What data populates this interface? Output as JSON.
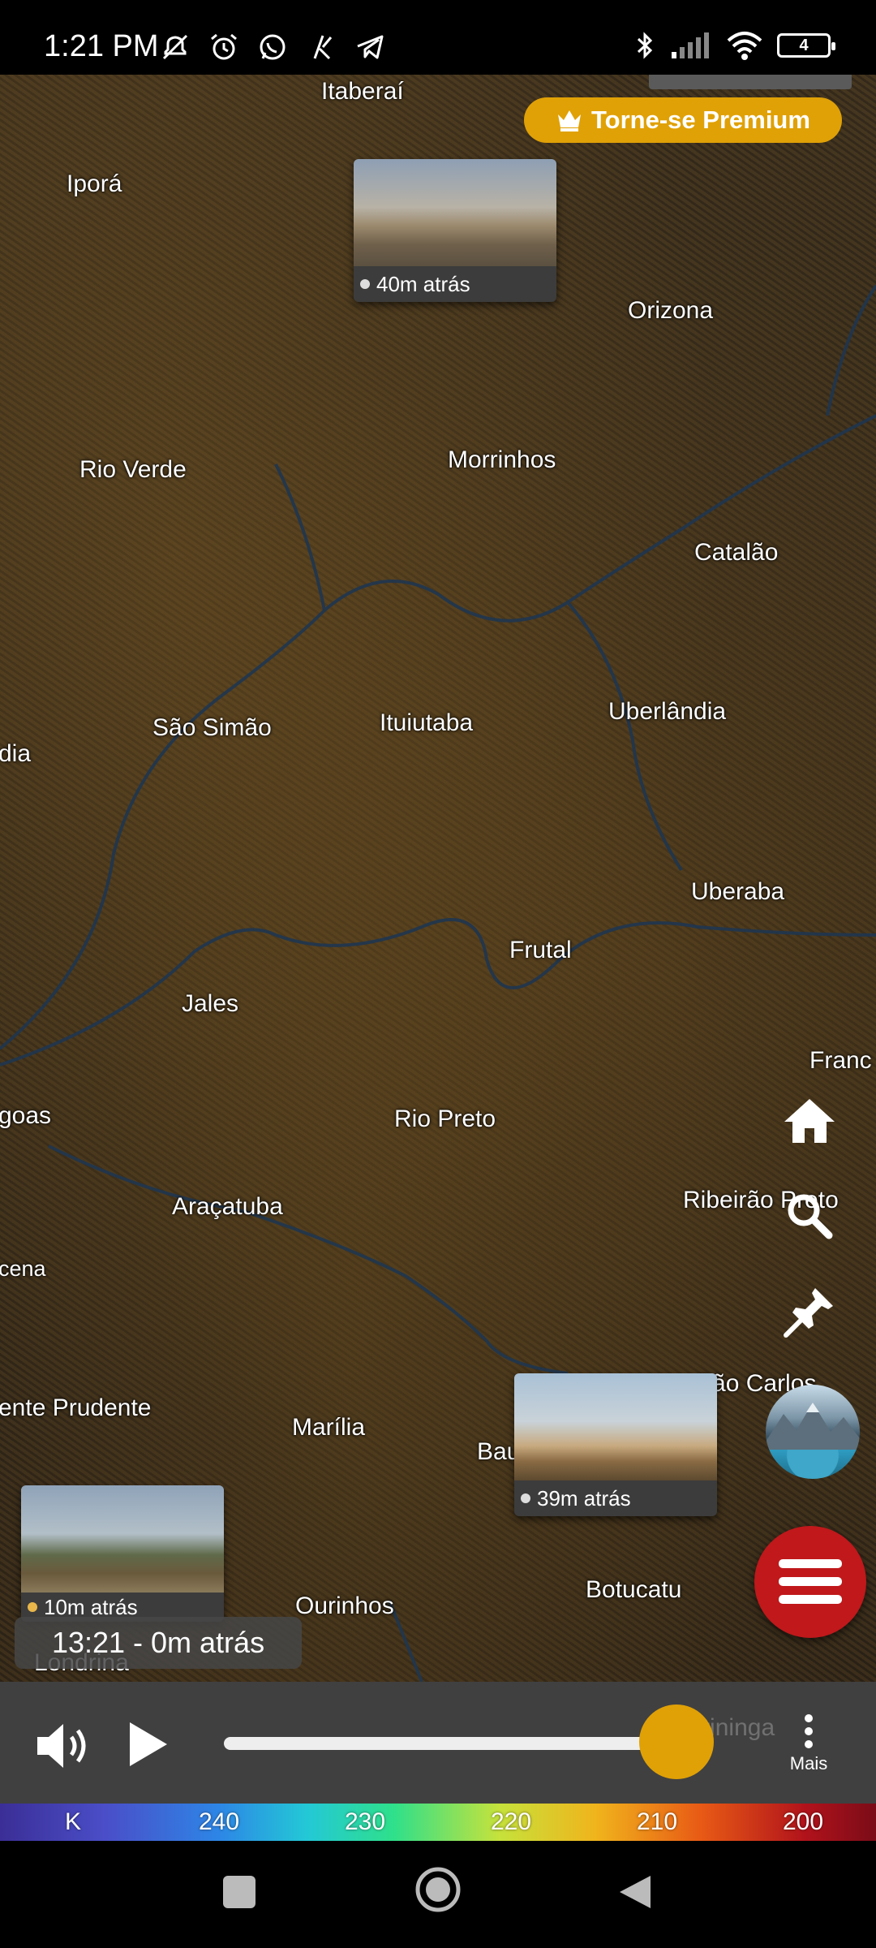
{
  "status_bar": {
    "time": "1:21 PM",
    "battery": "4",
    "icons": [
      "mute-icon",
      "alarm-icon",
      "whatsapp-icon",
      "app-icon",
      "telegram-icon",
      "bluetooth-icon",
      "signal-icon",
      "wifi-icon",
      "battery-icon"
    ]
  },
  "premium_button": {
    "label": "Torne-se Premium",
    "color": "#e0a106"
  },
  "map": {
    "cities": [
      {
        "name": "Itaberaí"
      },
      {
        "name": "Iporá"
      },
      {
        "name": "Orizona"
      },
      {
        "name": "Rio Verde"
      },
      {
        "name": "Morrinhos"
      },
      {
        "name": "Catalão"
      },
      {
        "name": "São Simão"
      },
      {
        "name": "Ituiutaba"
      },
      {
        "name": "Uberlândia"
      },
      {
        "name": "dia"
      },
      {
        "name": "Uberaba"
      },
      {
        "name": "Frutal"
      },
      {
        "name": "Jales"
      },
      {
        "name": "Franc"
      },
      {
        "name": "goas"
      },
      {
        "name": "Rio Preto"
      },
      {
        "name": "Araçatuba"
      },
      {
        "name": "Ribeirão Preto"
      },
      {
        "name": "cena"
      },
      {
        "name": "São Carlos"
      },
      {
        "name": "ente Prudente"
      },
      {
        "name": "Marília"
      },
      {
        "name": "Bau"
      },
      {
        "name": "Botucatu"
      },
      {
        "name": "Ourinhos"
      },
      {
        "name": "Londrina"
      }
    ],
    "webcams": [
      {
        "label": "40m atrás"
      },
      {
        "label": "39m atrás"
      },
      {
        "label": "10m atrás"
      }
    ]
  },
  "side_buttons": {
    "home": "home-icon",
    "search": "search-icon",
    "pin": "pin-icon"
  },
  "menu_button_color": "#c0181b",
  "time_label": "13:21 - 0m atrás",
  "player": {
    "ghost_city": "Itapetininga",
    "progress": 0.93,
    "more_label": "Mais"
  },
  "color_scale": {
    "unit": "K",
    "ticks": [
      "240",
      "230",
      "220",
      "210",
      "200"
    ]
  }
}
